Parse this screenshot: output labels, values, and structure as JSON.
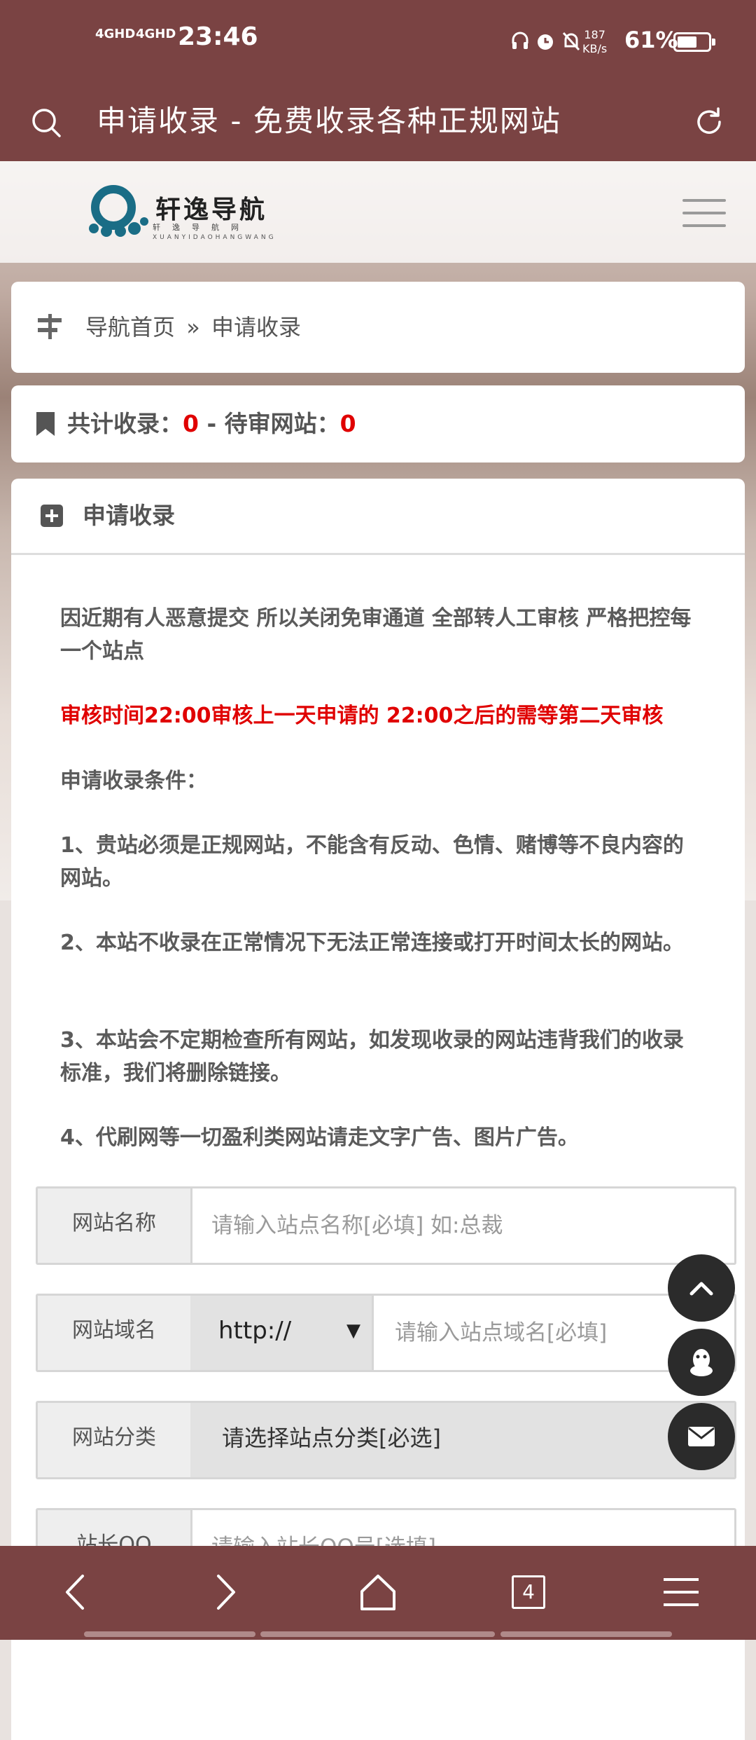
{
  "status_bar": {
    "signal1": "4GHD",
    "signal2": "4GHD",
    "time": "23:46",
    "net_speed_value": "187",
    "net_speed_unit": "KB/s",
    "battery_percent": "61%",
    "battery_level": 0.61
  },
  "browser": {
    "page_title": "申请收录 - 免费收录各种正规网站",
    "tab_count": "4"
  },
  "site": {
    "logo_name": "轩逸导航",
    "logo_sub": "轩逸导航网",
    "logo_pinyin": "XUANYIDAOHANGWANG"
  },
  "breadcrumb": {
    "home": "导航首页",
    "separator": "»",
    "current": "申请收录"
  },
  "counts": {
    "total_label": "共计收录：",
    "total_value": "0",
    "separator": " - ",
    "pending_label": "待审网站：",
    "pending_value": "0"
  },
  "panel": {
    "title": "申请收录",
    "notice_1": "因近期有人恶意提交 所以关闭免审通道 全部转人工审核 严格把控每一个站点",
    "notice_red": "审核时间22:00审核上一天申请的 22:00之后的需等第二天审核",
    "conditions_title": "申请收录条件：",
    "cond_1": "1、贵站必须是正规网站，不能含有反动、色情、赌博等不良内容的网站。",
    "cond_2": "2、本站不收录在正常情况下无法正常连接或打开时间太长的网站。",
    "cond_3": "3、本站会不定期检查所有网站，如发现收录的网站违背我们的收录标准，我们将删除链接。",
    "cond_4": "4、代刷网等一切盈利类网站请走文字广告、图片广告。"
  },
  "form": {
    "name_label": "网站名称",
    "name_placeholder": "请输入站点名称[必填] 如:总裁",
    "domain_label": "网站域名",
    "protocol": "http://",
    "domain_placeholder": "请输入站点域名[必填]",
    "category_label": "网站分类",
    "category_selected": "请选择站点分类[必选]",
    "qq_label": "站长QQ",
    "qq_placeholder": "请输入站长QQ号[选填]"
  },
  "colors": {
    "brand": "#7a4343",
    "alert_red": "#e00000",
    "fab": "#2b2b2b"
  },
  "icons": {
    "search": "search-icon",
    "refresh": "refresh-icon",
    "menu": "hamburger-icon",
    "breadcrumb": "signpost-icon",
    "bookmark": "bookmark-icon",
    "add": "plus-square-icon",
    "back_to_top": "chevron-up-icon",
    "qq": "qq-penguin-icon",
    "mail": "envelope-icon"
  }
}
